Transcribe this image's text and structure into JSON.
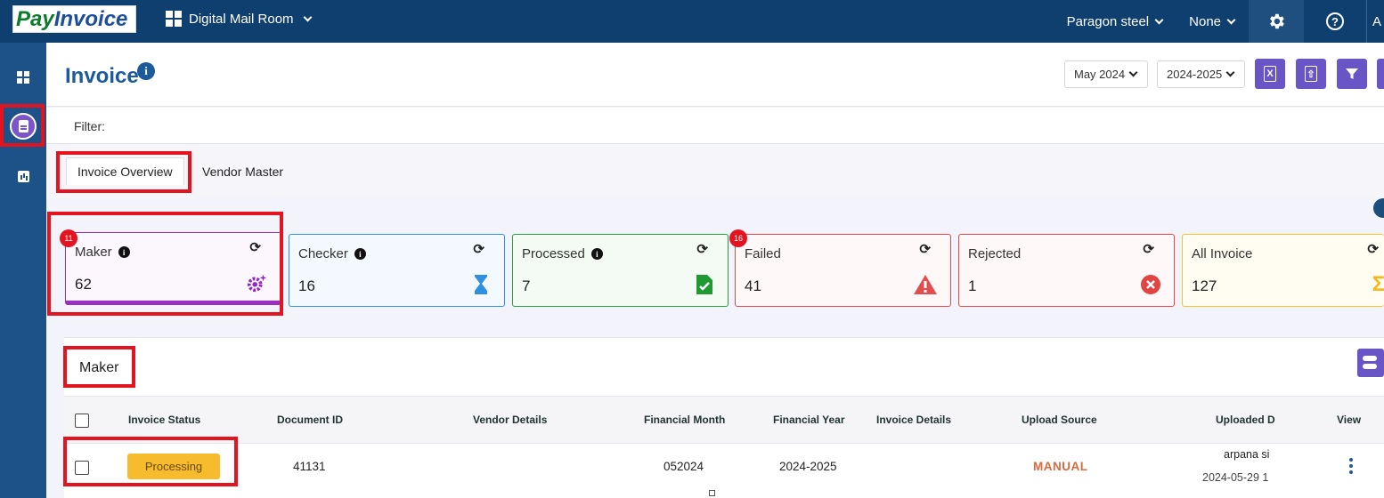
{
  "topbar": {
    "logo_pay": "Pay",
    "logo_invoice": "Invoice",
    "app_name": "Digital Mail Room",
    "company": "Paragon steel",
    "filter_none": "None",
    "gear_icon": "gear-icon",
    "help_label": "?",
    "avatar_letter": "A"
  },
  "sidebar": {
    "items": [
      {
        "name": "dashboard",
        "icon": "dashboard-icon"
      },
      {
        "name": "invoices",
        "icon": "document-icon",
        "active": true
      },
      {
        "name": "reports",
        "icon": "bar-chart-icon"
      }
    ]
  },
  "header": {
    "title": "Invoice",
    "info_glyph": "i",
    "month_select": "May 2024",
    "year_select": "2024-2025",
    "excel_label": "X",
    "upload_label": "⇧",
    "filter_icon": "funnel-icon"
  },
  "filter": {
    "label": "Filter:"
  },
  "tabs": [
    {
      "label": "Invoice Overview",
      "active": true
    },
    {
      "label": "Vendor Master",
      "active": false
    }
  ],
  "cards": [
    {
      "label": "Maker",
      "count": "62",
      "badge": "11",
      "border": "#9b2fc4",
      "bg": "#fbf7fd",
      "icon": "gears-icon"
    },
    {
      "label": "Checker",
      "count": "16",
      "badge": "",
      "border": "#2f8fe0",
      "bg": "#f4f9ff",
      "icon": "hourglass-icon"
    },
    {
      "label": "Processed",
      "count": "7",
      "badge": "",
      "border": "#2e9a3a",
      "bg": "#f4fbf4",
      "icon": "file-check-icon"
    },
    {
      "label": "Failed",
      "count": "41",
      "badge": "16",
      "border": "#e04a4a",
      "bg": "#fff8f8",
      "icon": "warning-icon"
    },
    {
      "label": "Rejected",
      "count": "1",
      "badge": "",
      "border": "#e04a4a",
      "bg": "#fff8f8",
      "icon": "x-circle-icon"
    },
    {
      "label": "All Invoice",
      "count": "127",
      "badge": "",
      "border": "#f3c330",
      "bg": "#fffcf2",
      "icon": "sigma-icon"
    }
  ],
  "section": {
    "title": "Maker",
    "columns": [
      "Invoice Status",
      "Document ID",
      "Vendor Details",
      "Financial Month",
      "Financial Year",
      "Invoice Details",
      "Upload Source",
      "Uploaded D",
      "View"
    ],
    "rows": [
      {
        "status": "Processing",
        "document_id": "41131",
        "vendor": "",
        "financial_month": "052024",
        "financial_year": "2024-2025",
        "invoice_details": "",
        "upload_source": "MANUAL",
        "uploaded_by": "arpana si",
        "uploaded_date": "2024-05-29 1"
      }
    ]
  },
  "colors": {
    "topbar": "#0f3f6e",
    "sidebar": "#1d5288",
    "accent": "#6a55c6",
    "highlight": "#e3141f",
    "status_processing": "#f6bc2d"
  }
}
